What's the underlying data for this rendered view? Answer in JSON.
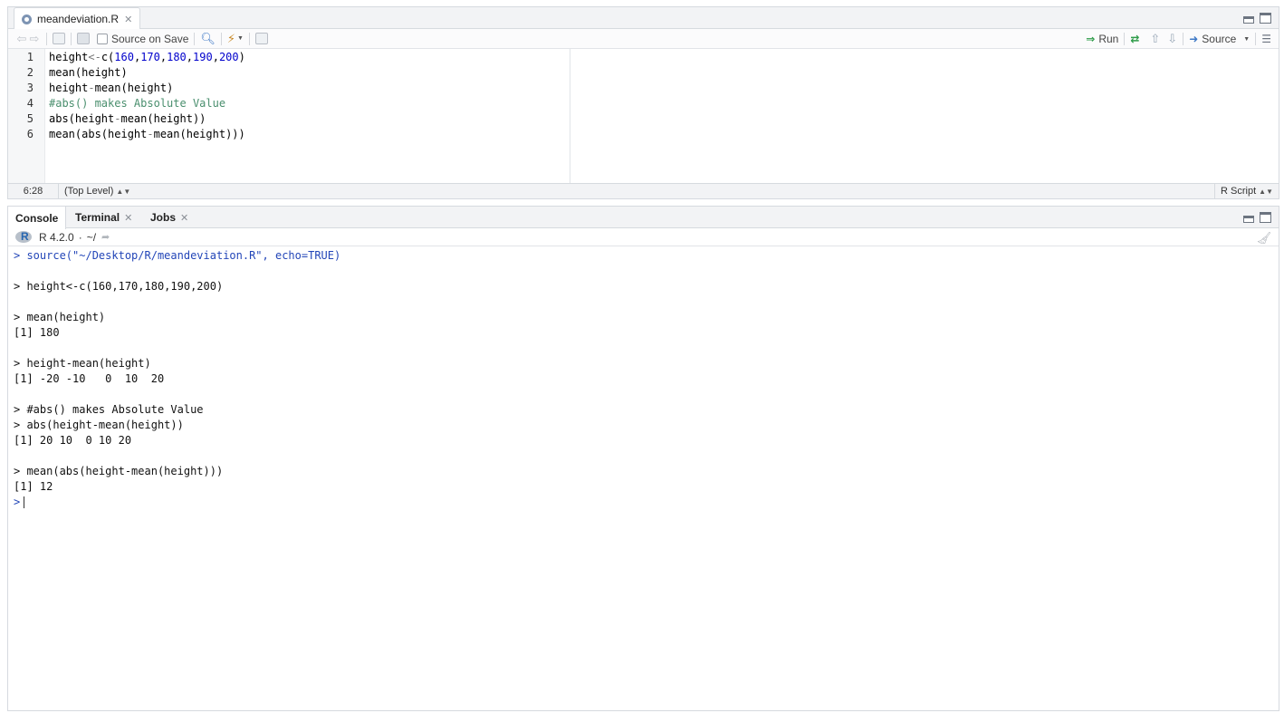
{
  "source_pane": {
    "tab": {
      "filename": "meandeviation.R"
    },
    "toolbar": {
      "source_on_save_label": "Source on Save",
      "run_label": "Run",
      "source_label": "Source"
    },
    "code_lines": [
      {
        "n": "1",
        "parts": [
          [
            "t",
            "height"
          ],
          [
            "o",
            "<-"
          ],
          [
            "t",
            "c("
          ],
          [
            "n",
            "160"
          ],
          [
            "t",
            ","
          ],
          [
            "n",
            "170"
          ],
          [
            "t",
            ","
          ],
          [
            "n",
            "180"
          ],
          [
            "t",
            ","
          ],
          [
            "n",
            "190"
          ],
          [
            "t",
            ","
          ],
          [
            "n",
            "200"
          ],
          [
            "t",
            ")"
          ]
        ]
      },
      {
        "n": "2",
        "parts": [
          [
            "t",
            "mean(height)"
          ]
        ]
      },
      {
        "n": "3",
        "parts": [
          [
            "t",
            "height"
          ],
          [
            "o",
            "-"
          ],
          [
            "t",
            "mean(height)"
          ]
        ]
      },
      {
        "n": "4",
        "parts": [
          [
            "c",
            "#abs() makes Absolute Value"
          ]
        ]
      },
      {
        "n": "5",
        "parts": [
          [
            "t",
            "abs(height"
          ],
          [
            "o",
            "-"
          ],
          [
            "t",
            "mean(height))"
          ]
        ]
      },
      {
        "n": "6",
        "parts": [
          [
            "t",
            "mean(abs(height"
          ],
          [
            "o",
            "-"
          ],
          [
            "t",
            "mean(height)))"
          ]
        ]
      }
    ],
    "status": {
      "cursor_pos": "6:28",
      "scope": "(Top Level)",
      "file_type": "R Script"
    }
  },
  "console_pane": {
    "tabs": [
      {
        "label": "Console",
        "closable": false
      },
      {
        "label": "Terminal",
        "closable": true
      },
      {
        "label": "Jobs",
        "closable": true
      }
    ],
    "r_version": "R 4.2.0",
    "working_dir": "~/",
    "lines": [
      {
        "kind": "src",
        "text": "> source(\"~/Desktop/R/meandeviation.R\", echo=TRUE)"
      },
      {
        "kind": "blank",
        "text": ""
      },
      {
        "kind": "out",
        "text": "> height<-c(160,170,180,190,200)"
      },
      {
        "kind": "blank",
        "text": ""
      },
      {
        "kind": "out",
        "text": "> mean(height)"
      },
      {
        "kind": "out",
        "text": "[1] 180"
      },
      {
        "kind": "blank",
        "text": ""
      },
      {
        "kind": "out",
        "text": "> height-mean(height)"
      },
      {
        "kind": "out",
        "text": "[1] -20 -10   0  10  20"
      },
      {
        "kind": "blank",
        "text": ""
      },
      {
        "kind": "out",
        "text": "> #abs() makes Absolute Value"
      },
      {
        "kind": "out",
        "text": "> abs(height-mean(height))"
      },
      {
        "kind": "out",
        "text": "[1] 20 10  0 10 20"
      },
      {
        "kind": "blank",
        "text": ""
      },
      {
        "kind": "out",
        "text": "> mean(abs(height-mean(height)))"
      },
      {
        "kind": "out",
        "text": "[1] 12"
      }
    ],
    "prompt": ">"
  },
  "colors": {
    "accent_blue": "#2346b8",
    "number_blue": "#0000cc",
    "comment_green": "#4a8f6e",
    "run_green": "#2e9c49"
  }
}
